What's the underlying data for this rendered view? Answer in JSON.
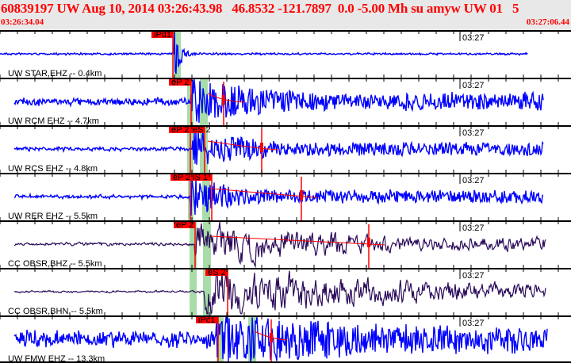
{
  "header": {
    "title": "60839197 UW Aug 10, 2014 03:26:43.98   46.8532 -121.7897  0.0 -5.00 Mh su amyw UW 01   5",
    "start_time": "03:26:34.04",
    "end_time": "03:27:06.44"
  },
  "minute_label": "03:27",
  "colors": {
    "trace_blue": "#0000ff",
    "trace_purple": "#2a0a5a",
    "pick": "#ff0000",
    "window": "#a8dca8",
    "header_bg": "#e8e8e8"
  },
  "traces": [
    {
      "label": "UW STAR,EHZ -- 0.4km",
      "picks": [
        "iPd1"
      ],
      "color": "trace_blue"
    },
    {
      "label": "UW RCM EHZ -- 4.7km",
      "picks": [
        "eP 2"
      ],
      "color": "trace_blue"
    },
    {
      "label": "UW RCS EHZ -- 4.8km",
      "picks": [
        "eP 2",
        "eS 2"
      ],
      "color": "trace_blue"
    },
    {
      "label": "UW RER EHZ -- 5.5km",
      "picks": [
        "eP 2",
        "iS 1"
      ],
      "color": "trace_blue"
    },
    {
      "label": "CC OBSR,BHZ -- 5.5km",
      "picks": [
        "eP 2"
      ],
      "color": "trace_purple"
    },
    {
      "label": "CC OBSR,BHN -- 5.5km",
      "picks": [
        "eS 2"
      ],
      "color": "trace_purple"
    },
    {
      "label": "UW FMW EHZ -- 13.3km",
      "picks": [
        "iPc1"
      ],
      "color": "trace_blue"
    }
  ]
}
